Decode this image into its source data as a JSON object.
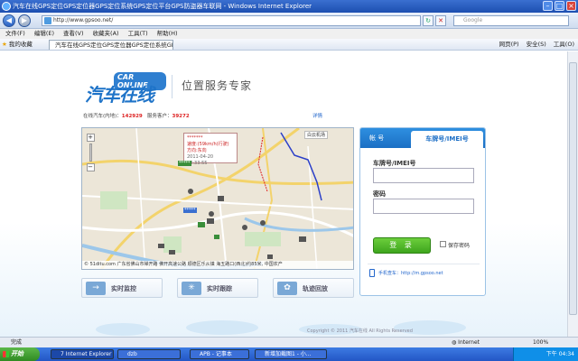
{
  "window": {
    "title": "汽车在线GPS定位GPS定位器GPS定位系统GPS定位平台GPS防盗器车联网 - Windows Internet Explorer"
  },
  "address": {
    "url": "http://www.gpsoo.net/",
    "search_placeholder": "Google"
  },
  "menu": [
    "文件(F)",
    "编辑(E)",
    "查看(V)",
    "收藏夹(A)",
    "工具(T)",
    "帮助(H)"
  ],
  "favorites": {
    "label": "我的收藏",
    "tab_title": "汽车在线GPS定位GPS定位器GPS定位系统GPS",
    "tools": [
      "网页(P)",
      "安全(S)",
      "工具(O)"
    ]
  },
  "page": {
    "logo_en": "CAR ONLINE",
    "logo_cn": "汽车在线",
    "slogan": "位置服务专家",
    "stats_label1": "在线汽车(内地)：",
    "stats_value1": "142929",
    "stats_label2": "服务客户：",
    "stats_value2": "39272",
    "stats_link": "详情",
    "map": {
      "popup_line1": "*******",
      "popup_speed": "速度:(59km/h(行驶)",
      "popup_dir": "方向:东向",
      "popup_time": "2011-04-20 18:33:55",
      "label_top": "白云机场",
      "tag1": "*****",
      "tag2": "*****",
      "footer": "© 51ditu.com  广东省佛山市禅开路 佛开高速公路 顺德区乐从镇 海五路口(西北)约85米, 中国农产"
    },
    "login": {
      "tab_account": "帐 号",
      "tab_plate": "车牌号/IMEI号",
      "plate_label": "车牌号/IMEI号",
      "password_label": "密码",
      "login_button": "登 录",
      "remember_label": "保存密码",
      "mobile_link": "手机查车：http://m.gpsoo.net"
    },
    "features": [
      {
        "icon": "→",
        "label": "实时监控"
      },
      {
        "icon": "✳",
        "label": "实时跟踪"
      },
      {
        "icon": "✿",
        "label": "轨迹回放"
      }
    ],
    "copyright": "Copyright © 2011 汽车在线 All Rights Reserved"
  },
  "statusbar": {
    "done": "完成",
    "zone": "Internet",
    "zoom": "100%"
  },
  "taskbar": {
    "start": "开始",
    "tasks": [
      "7 Internet Explorer",
      "dzb",
      "APB - 记事本",
      "新增加截图1 - 小..."
    ],
    "clock": "下午 04:34"
  }
}
